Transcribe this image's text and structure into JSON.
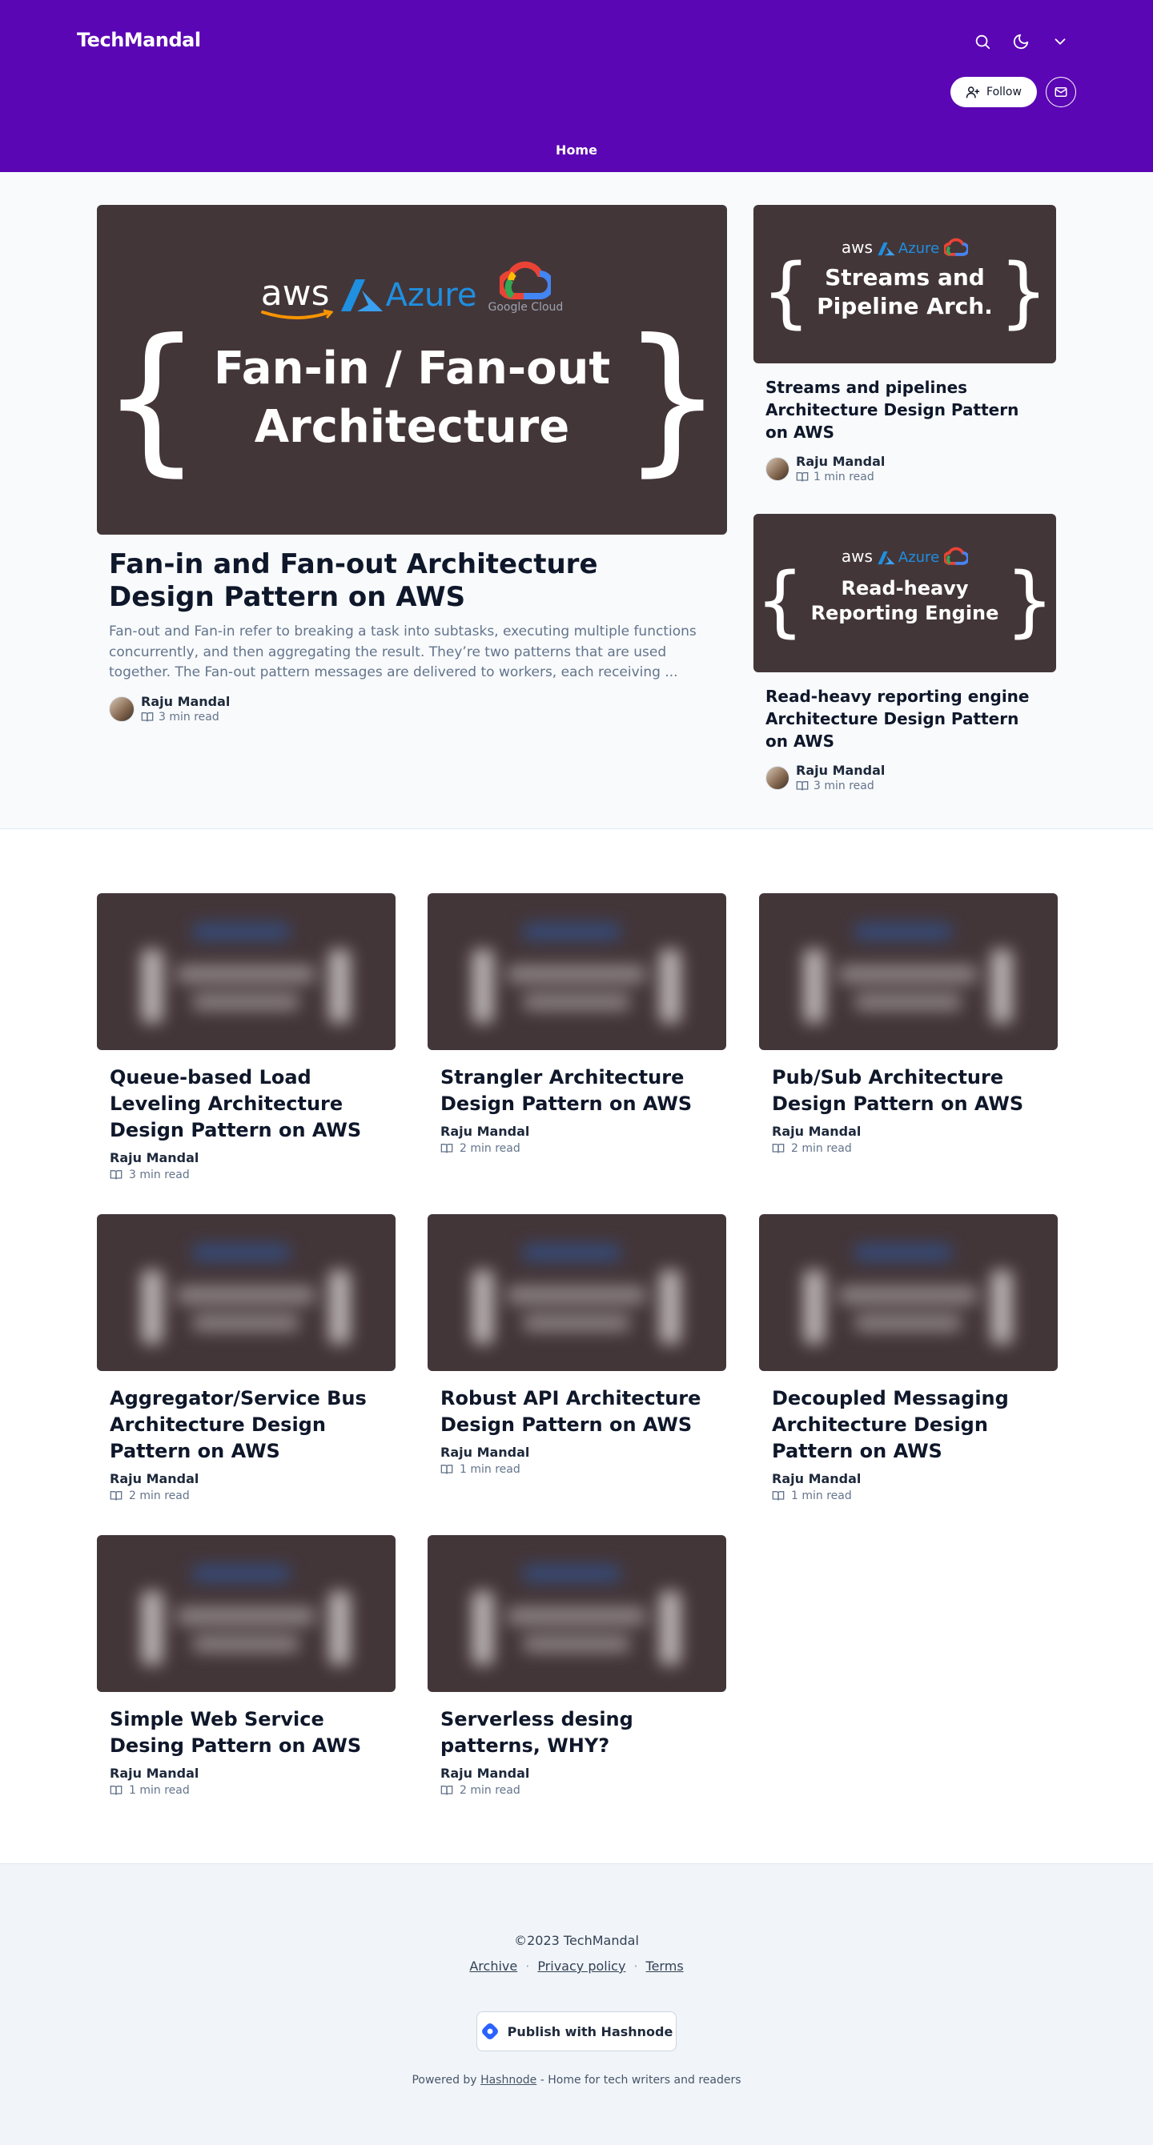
{
  "header": {
    "brand": "TechMandal",
    "follow_label": "Follow",
    "nav_home": "Home",
    "bg_color": "#5b06b4"
  },
  "thumbs": {
    "aws": "aws",
    "azure": "Azure",
    "gcloud": "Google Cloud",
    "brace_open": "{",
    "brace_close": "}",
    "hero_line1": "Fan-in / Fan-out",
    "hero_line2": "Architecture",
    "side1_line1": "Streams and",
    "side1_line2": "Pipeline Arch.",
    "side2_line1": "Read-heavy",
    "side2_line2": "Reporting Engine"
  },
  "featured": {
    "title": "Fan-in and Fan-out Architecture Design Pattern on AWS",
    "excerpt": "Fan-out and Fan-in refer to breaking a task into subtasks, executing multiple functions concurrently, and then aggregating the result. They’re two patterns that are used together. The Fan-out pattern messages are delivered to workers, each receiving ...",
    "author": "Raju Mandal",
    "read_time": "3 min read"
  },
  "side_posts": [
    {
      "title": "Streams and pipelines Architecture Design Pattern on AWS",
      "author": "Raju Mandal",
      "read_time": "1 min read"
    },
    {
      "title": "Read-heavy reporting engine Architecture Design Pattern on AWS",
      "author": "Raju Mandal",
      "read_time": "3 min read"
    }
  ],
  "grid_posts": [
    {
      "title": "Queue-based Load Leveling Architecture Design Pattern on AWS",
      "author": "Raju Mandal",
      "read_time": "3 min read"
    },
    {
      "title": "Strangler Architecture Design Pattern on AWS",
      "author": "Raju Mandal",
      "read_time": "2 min read"
    },
    {
      "title": "Pub/Sub Architecture Design Pattern on AWS",
      "author": "Raju Mandal",
      "read_time": "2 min read"
    },
    {
      "title": "Aggregator/Service Bus Architecture Design Pattern on AWS",
      "author": "Raju Mandal",
      "read_time": "2 min read"
    },
    {
      "title": "Robust API Architecture Design Pattern on AWS",
      "author": "Raju Mandal",
      "read_time": "1 min read"
    },
    {
      "title": "Decoupled Messaging Architecture Design Pattern on AWS",
      "author": "Raju Mandal",
      "read_time": "1 min read"
    },
    {
      "title": "Simple Web Service Desing Pattern on AWS",
      "author": "Raju Mandal",
      "read_time": "1 min read"
    },
    {
      "title": "Serverless desing patterns, WHY?",
      "author": "Raju Mandal",
      "read_time": "2 min read"
    }
  ],
  "footer": {
    "copyright": "©2023 TechMandal",
    "links": [
      "Archive",
      "Privacy policy",
      "Terms"
    ],
    "separator": "·",
    "publish_label": "Publish with Hashnode",
    "powered_prefix": "Powered by",
    "powered_link": "Hashnode",
    "powered_suffix": "- Home for tech writers and readers"
  },
  "icons": [
    "search-icon",
    "moon-icon",
    "chevron-down-icon",
    "user-plus-icon",
    "mail-icon",
    "book-icon",
    "hashnode-logo-icon"
  ]
}
